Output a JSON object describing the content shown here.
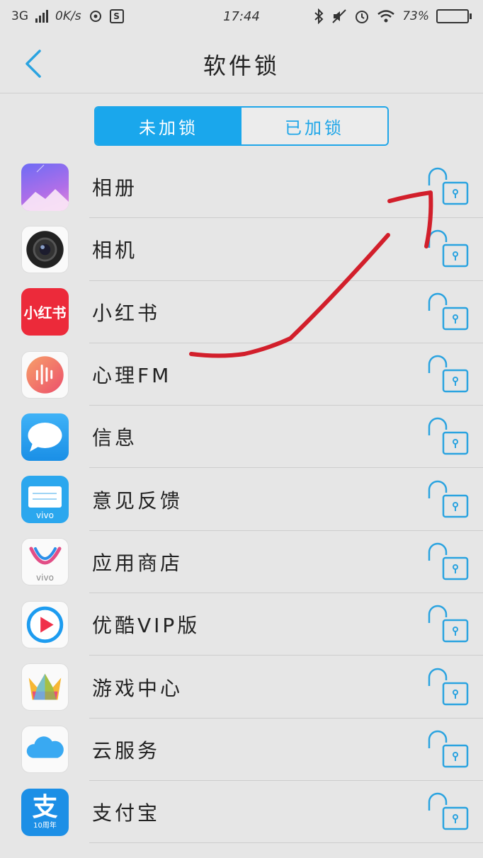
{
  "status_bar": {
    "network": "3G",
    "speed": "0K/s",
    "s_icon": "S",
    "time": "17:44",
    "battery": "73%",
    "battery_level": 0.73,
    "icons": [
      "signal-bars-icon",
      "hotspot-icon",
      "bluetooth-icon",
      "mute-icon",
      "alarm-icon",
      "wifi-icon",
      "battery-icon"
    ]
  },
  "header": {
    "title": "软件锁",
    "back_icon": "chevron-left-icon"
  },
  "tabs": [
    {
      "label": "未加锁",
      "active": true
    },
    {
      "label": "已加锁",
      "active": false
    }
  ],
  "apps": [
    {
      "name": "相册",
      "icon": "album-icon",
      "locked": false
    },
    {
      "name": "相机",
      "icon": "camera-icon",
      "locked": false
    },
    {
      "name": "小红书",
      "icon": "xiaohongshu-icon",
      "icon_text": "小红书",
      "locked": false
    },
    {
      "name": "心理FM",
      "icon": "xinli-fm-icon",
      "locked": false
    },
    {
      "name": "信息",
      "icon": "messages-icon",
      "locked": false
    },
    {
      "name": "意见反馈",
      "icon": "feedback-icon",
      "icon_text": "vivo",
      "locked": false
    },
    {
      "name": "应用商店",
      "icon": "app-store-icon",
      "icon_text": "vivo",
      "locked": false
    },
    {
      "name": "优酷VIP版",
      "icon": "youku-icon",
      "locked": false
    },
    {
      "name": "游戏中心",
      "icon": "game-center-icon",
      "locked": false
    },
    {
      "name": "云服务",
      "icon": "cloud-icon",
      "locked": false
    },
    {
      "name": "支付宝",
      "icon": "alipay-icon",
      "icon_text": "支",
      "icon_subtext": "10周年",
      "locked": false
    }
  ],
  "colors": {
    "accent": "#1aa7ec",
    "lock_icon": "#2aa3e0",
    "annotation": "#d21f2b"
  }
}
